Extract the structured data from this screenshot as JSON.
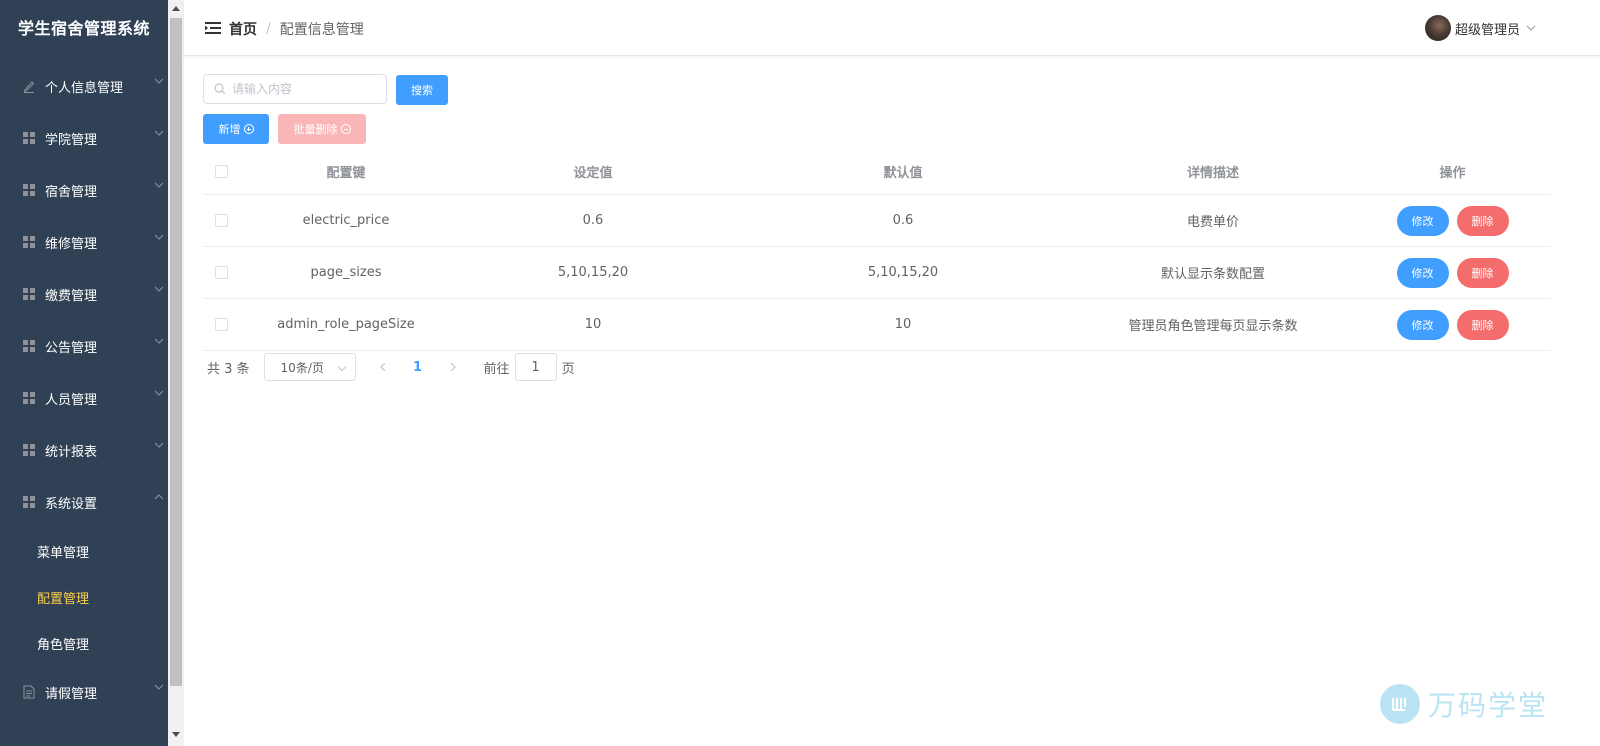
{
  "sidebar": {
    "brand": "学生宿舍管理系统",
    "items": [
      {
        "label": "个人信息管理",
        "icon": "edit-icon"
      },
      {
        "label": "学院管理",
        "icon": "grid-icon"
      },
      {
        "label": "宿舍管理",
        "icon": "grid-icon"
      },
      {
        "label": "维修管理",
        "icon": "grid-icon"
      },
      {
        "label": "缴费管理",
        "icon": "grid-icon"
      },
      {
        "label": "公告管理",
        "icon": "grid-icon"
      },
      {
        "label": "人员管理",
        "icon": "grid-icon"
      },
      {
        "label": "统计报表",
        "icon": "grid-icon"
      },
      {
        "label": "系统设置",
        "icon": "grid-icon"
      }
    ],
    "sub_items": [
      {
        "label": "菜单管理"
      },
      {
        "label": "配置管理"
      },
      {
        "label": "角色管理"
      }
    ],
    "after_item": {
      "label": "请假管理",
      "icon": "document-icon"
    },
    "active_color": "#ffd04b",
    "bg_color": "#304156"
  },
  "header": {
    "breadcrumb_home": "首页",
    "breadcrumb_sep": "/",
    "breadcrumb_current": "配置信息管理",
    "user_name": "超级管理员"
  },
  "toolbar": {
    "search_placeholder": "请输入内容",
    "search_button": "搜索",
    "add_button": "新增",
    "batch_delete_button": "批量删除"
  },
  "table": {
    "headers": [
      "配置键",
      "设定值",
      "默认值",
      "详情描述",
      "操作"
    ],
    "rows": [
      {
        "key": "electric_price",
        "value": "0.6",
        "default": "0.6",
        "desc": "电费单价"
      },
      {
        "key": "page_sizes",
        "value": "5,10,15,20",
        "default": "5,10,15,20",
        "desc": "默认显示条数配置"
      },
      {
        "key": "admin_role_pageSize",
        "value": "10",
        "default": "10",
        "desc": "管理员角色管理每页显示条数"
      }
    ],
    "edit_label": "修改",
    "delete_label": "删除"
  },
  "pagination": {
    "total": "共 3 条",
    "page_size": "10条/页",
    "current_page": "1",
    "goto_label": "前往",
    "goto_value": "1",
    "goto_suffix": "页"
  },
  "watermark": "万码学堂",
  "colors": {
    "primary": "#409eff",
    "danger": "#f56c6c",
    "danger_disabled": "#fab6b6"
  }
}
